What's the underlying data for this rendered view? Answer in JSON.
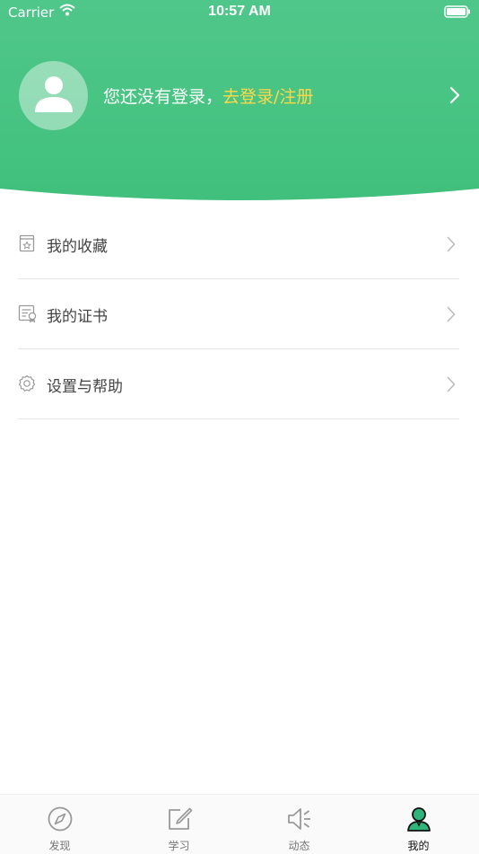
{
  "status_bar": {
    "carrier": "Carrier",
    "time": "10:57 AM"
  },
  "profile": {
    "prompt": "您还没有登录，",
    "login_link": "去登录/注册",
    "gradient_top": "#52c58a",
    "gradient_bottom": "#3ec17c",
    "link_color": "#ffd84a"
  },
  "menu": {
    "items": [
      {
        "label": "我的收藏",
        "icon": "favorites-icon"
      },
      {
        "label": "我的证书",
        "icon": "certificate-icon"
      },
      {
        "label": "设置与帮助",
        "icon": "settings-icon"
      }
    ]
  },
  "tabbar": {
    "tabs": [
      {
        "label": "发现",
        "icon": "compass-icon",
        "active": false
      },
      {
        "label": "学习",
        "icon": "edit-icon",
        "active": false
      },
      {
        "label": "动态",
        "icon": "speaker-icon",
        "active": false
      },
      {
        "label": "我的",
        "icon": "user-icon",
        "active": true
      }
    ],
    "active_color": "#2fb47a"
  }
}
